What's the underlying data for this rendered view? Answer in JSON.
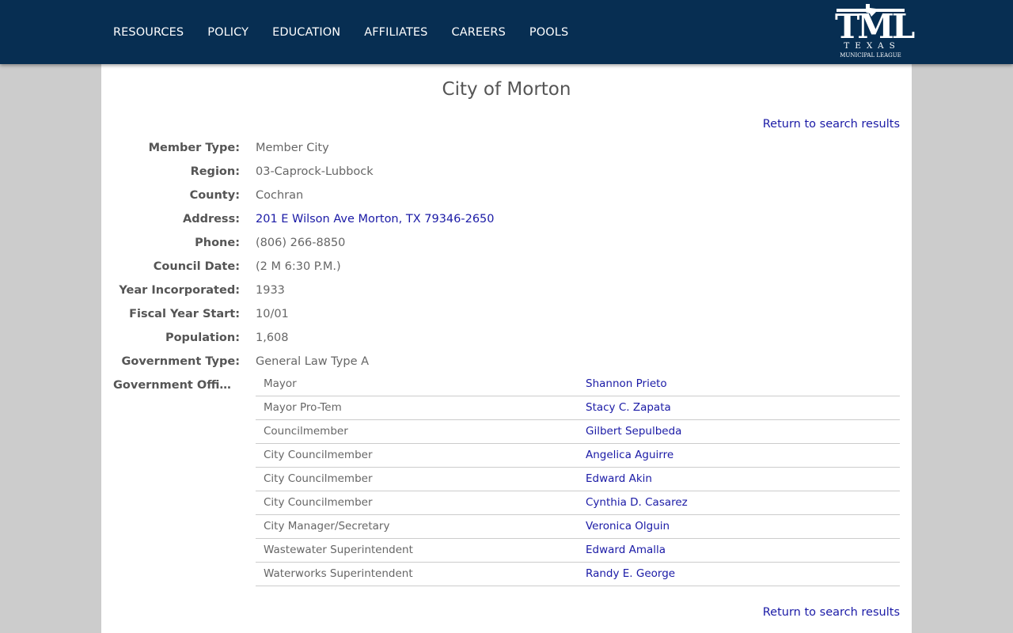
{
  "nav": {
    "items": [
      "RESOURCES",
      "POLICY",
      "EDUCATION",
      "AFFILIATES",
      "CAREERS",
      "POOLS"
    ]
  },
  "logo": {
    "main": "TML",
    "line1": "TEXAS",
    "line2": "MUNICIPAL LEAGUE"
  },
  "page": {
    "title": "City of Morton",
    "return_label": "Return to search results"
  },
  "fields": [
    {
      "label": "Member Type:",
      "value": "Member City"
    },
    {
      "label": "Region:",
      "value": "03-Caprock-Lubbock"
    },
    {
      "label": "County:",
      "value": "Cochran"
    },
    {
      "label": "Address:",
      "value": "201 E Wilson Ave Morton, TX 79346-2650"
    },
    {
      "label": "Phone:",
      "value": "(806) 266-8850"
    },
    {
      "label": "Council Date:",
      "value": "(2 M 6:30 P.M.)"
    },
    {
      "label": "Year Incorporated:",
      "value": "1933"
    },
    {
      "label": "Fiscal Year Start:",
      "value": "10/01"
    },
    {
      "label": "Population:",
      "value": "1,608"
    },
    {
      "label": "Government Type:",
      "value": "General Law Type A"
    }
  ],
  "officials": {
    "label": "Government Offici...",
    "rows": [
      {
        "title": "Mayor",
        "name": "Shannon Prieto"
      },
      {
        "title": "Mayor Pro-Tem",
        "name": "Stacy C. Zapata"
      },
      {
        "title": "Councilmember",
        "name": "Gilbert Sepulbeda"
      },
      {
        "title": "City Councilmember",
        "name": "Angelica Aguirre"
      },
      {
        "title": "City Councilmember",
        "name": "Edward Akin"
      },
      {
        "title": "City Councilmember",
        "name": "Cynthia D. Casarez"
      },
      {
        "title": "City Manager/Secretary",
        "name": "Veronica Olguin"
      },
      {
        "title": "Wastewater Superintendent",
        "name": "Edward Amalla"
      },
      {
        "title": "Waterworks Superintendent",
        "name": "Randy E. George"
      }
    ]
  },
  "colors": {
    "header_bg": "#072e52",
    "link": "#1a1aa6",
    "page_bg": "#cccccc"
  }
}
